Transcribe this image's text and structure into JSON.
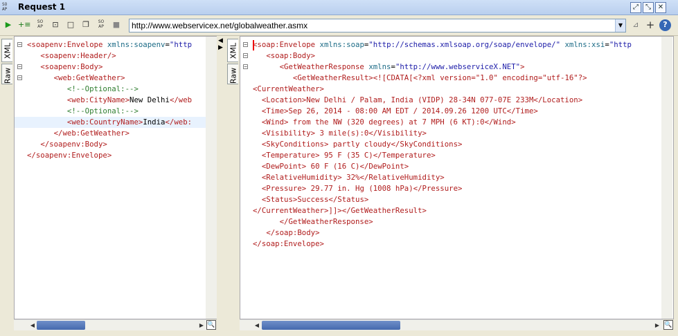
{
  "window": {
    "title": "Request 1",
    "app_icon_text": "SO\nAP"
  },
  "toolbar": {
    "buttons": [
      "play-icon",
      "add-assertion-icon",
      "soap-icon",
      "expand-icon",
      "stop-square-icon",
      "copy-icon",
      "soap2-icon",
      "stop-icon"
    ],
    "url": "http://www.webservicex.net/globalweather.asmx",
    "right_icons": [
      "filter-icon",
      "plus-icon",
      "help-icon"
    ]
  },
  "request": {
    "tabs": [
      "XML",
      "Raw"
    ],
    "lines": [
      [
        [
          "tag",
          "<soapenv:Envelope "
        ],
        [
          "attr",
          "xmlns:soapenv"
        ],
        [
          "txt",
          "="
        ],
        [
          "val",
          "\"http"
        ]
      ],
      [
        [
          "txt",
          "   "
        ],
        [
          "tag",
          "<soapenv:Header/>"
        ]
      ],
      [
        [
          "txt",
          "   "
        ],
        [
          "tag",
          "<soapenv:Body>"
        ]
      ],
      [
        [
          "txt",
          "      "
        ],
        [
          "tag",
          "<web:GetWeather>"
        ]
      ],
      [
        [
          "txt",
          "         "
        ],
        [
          "cm",
          "<!--Optional:-->"
        ]
      ],
      [
        [
          "txt",
          "         "
        ],
        [
          "tag",
          "<web:CityName>"
        ],
        [
          "txt",
          "New Delhi"
        ],
        [
          "tag",
          "</web"
        ]
      ],
      [
        [
          "txt",
          "         "
        ],
        [
          "cm",
          "<!--Optional:-->"
        ]
      ],
      [
        [
          "txt",
          "         "
        ],
        [
          "tag",
          "<web:CountryName>"
        ],
        [
          "txt",
          "India"
        ],
        [
          "tag",
          "</web:"
        ]
      ],
      [
        [
          "txt",
          "      "
        ],
        [
          "tag",
          "</web:GetWeather>"
        ]
      ],
      [
        [
          "txt",
          "   "
        ],
        [
          "tag",
          "</soapenv:Body>"
        ]
      ],
      [
        [
          "tag",
          "</soapenv:Envelope>"
        ]
      ]
    ]
  },
  "response": {
    "tabs": [
      "XML",
      "Raw"
    ],
    "lines": [
      [
        [
          "tag",
          "<soap:Envelope "
        ],
        [
          "attr",
          "xmlns:soap"
        ],
        [
          "txt",
          "="
        ],
        [
          "val",
          "\"http://schemas.xmlsoap.org/soap/envelope/\""
        ],
        [
          "txt",
          " "
        ],
        [
          "attr",
          "xmlns:xsi"
        ],
        [
          "txt",
          "="
        ],
        [
          "val",
          "\"http"
        ]
      ],
      [
        [
          "txt",
          "   "
        ],
        [
          "tag",
          "<soap:Body>"
        ]
      ],
      [
        [
          "txt",
          "      "
        ],
        [
          "tag",
          "<GetWeatherResponse "
        ],
        [
          "attr",
          "xmlns"
        ],
        [
          "txt",
          "="
        ],
        [
          "val",
          "\"http://www.webserviceX.NET\""
        ],
        [
          "tag",
          ">"
        ]
      ],
      [
        [
          "txt",
          "         "
        ],
        [
          "tag",
          "<GetWeatherResult>"
        ],
        [
          "tag",
          "<![CDATA["
        ],
        [
          "tag",
          "<?xml version=\"1.0\" encoding=\"utf-16\"?>"
        ]
      ],
      [
        [
          "tag",
          "<CurrentWeather>"
        ]
      ],
      [
        [
          "txt",
          "  "
        ],
        [
          "tag",
          "<Location>"
        ],
        [
          "tag",
          "New Delhi / Palam, India (VIDP) 28-34N 077-07E 233M"
        ],
        [
          "tag",
          "</Location>"
        ]
      ],
      [
        [
          "txt",
          "  "
        ],
        [
          "tag",
          "<Time>"
        ],
        [
          "tag",
          "Sep 26, 2014 - 08:00 AM EDT / 2014.09.26 1200 UTC"
        ],
        [
          "tag",
          "</Time>"
        ]
      ],
      [
        [
          "txt",
          "  "
        ],
        [
          "tag",
          "<Wind>"
        ],
        [
          "tag",
          " from the NW (320 degrees) at 7 MPH (6 KT):0"
        ],
        [
          "tag",
          "</Wind>"
        ]
      ],
      [
        [
          "txt",
          "  "
        ],
        [
          "tag",
          "<Visibility>"
        ],
        [
          "tag",
          " 3 mile(s):0"
        ],
        [
          "tag",
          "</Visibility>"
        ]
      ],
      [
        [
          "txt",
          "  "
        ],
        [
          "tag",
          "<SkyConditions>"
        ],
        [
          "tag",
          " partly cloudy"
        ],
        [
          "tag",
          "</SkyConditions>"
        ]
      ],
      [
        [
          "txt",
          "  "
        ],
        [
          "tag",
          "<Temperature>"
        ],
        [
          "tag",
          " 95 F (35 C)"
        ],
        [
          "tag",
          "</Temperature>"
        ]
      ],
      [
        [
          "txt",
          "  "
        ],
        [
          "tag",
          "<DewPoint>"
        ],
        [
          "tag",
          " 60 F (16 C)"
        ],
        [
          "tag",
          "</DewPoint>"
        ]
      ],
      [
        [
          "txt",
          "  "
        ],
        [
          "tag",
          "<RelativeHumidity>"
        ],
        [
          "tag",
          " 32%"
        ],
        [
          "tag",
          "</RelativeHumidity>"
        ]
      ],
      [
        [
          "txt",
          "  "
        ],
        [
          "tag",
          "<Pressure>"
        ],
        [
          "tag",
          " 29.77 in. Hg (1008 hPa)"
        ],
        [
          "tag",
          "</Pressure>"
        ]
      ],
      [
        [
          "txt",
          "  "
        ],
        [
          "tag",
          "<Status>"
        ],
        [
          "tag",
          "Success"
        ],
        [
          "tag",
          "</Status>"
        ]
      ],
      [
        [
          "tag",
          "</CurrentWeather>"
        ],
        [
          "tag",
          "]]>"
        ],
        [
          "tag",
          "</GetWeatherResult>"
        ]
      ],
      [
        [
          "txt",
          "      "
        ],
        [
          "tag",
          "</GetWeatherResponse>"
        ]
      ],
      [
        [
          "txt",
          "   "
        ],
        [
          "tag",
          "</soap:Body>"
        ]
      ],
      [
        [
          "tag",
          "</soap:Envelope>"
        ]
      ]
    ]
  }
}
